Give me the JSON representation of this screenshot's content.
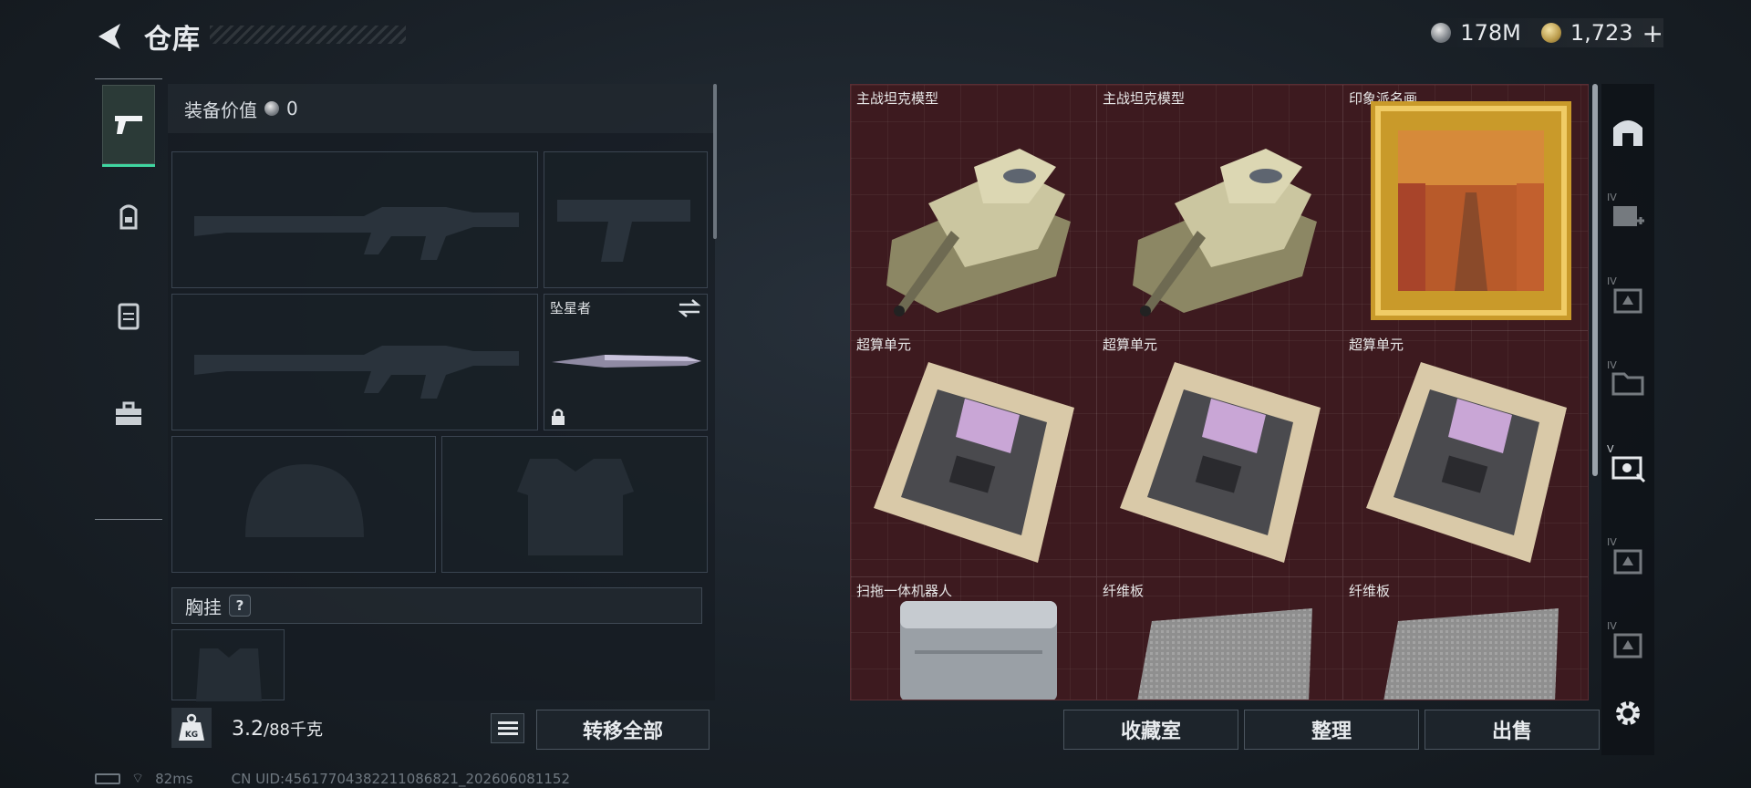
{
  "header": {
    "title": "仓库"
  },
  "currency": {
    "silver": "178M",
    "gold": "1,723",
    "add_symbol": "+"
  },
  "equipment": {
    "label": "装备价值",
    "value": "0"
  },
  "slots": {
    "melee_name": "坠星者"
  },
  "vest": {
    "label": "胸挂",
    "help": "?"
  },
  "weight": {
    "current": "3.2",
    "capacity": "/88千克",
    "icon_text": "KG"
  },
  "actions": {
    "transfer_all": "转移全部",
    "collection": "收藏室",
    "organize": "整理",
    "sell": "出售"
  },
  "status": {
    "ping": "82ms",
    "uid": "CN UID:45617704382211086821_202606081152"
  },
  "grid_items": [
    {
      "label": "主战坦克模型"
    },
    {
      "label": "主战坦克模型"
    },
    {
      "label": "印象派名画"
    },
    {
      "label": "超算单元"
    },
    {
      "label": "超算单元"
    },
    {
      "label": "超算单元"
    },
    {
      "label": "扫拖一体机器人"
    },
    {
      "label": "纤维板"
    },
    {
      "label": "纤维板"
    }
  ],
  "sidebar_numerals": [
    "IV",
    "IV",
    "IV",
    "V",
    "IV",
    "IV"
  ]
}
